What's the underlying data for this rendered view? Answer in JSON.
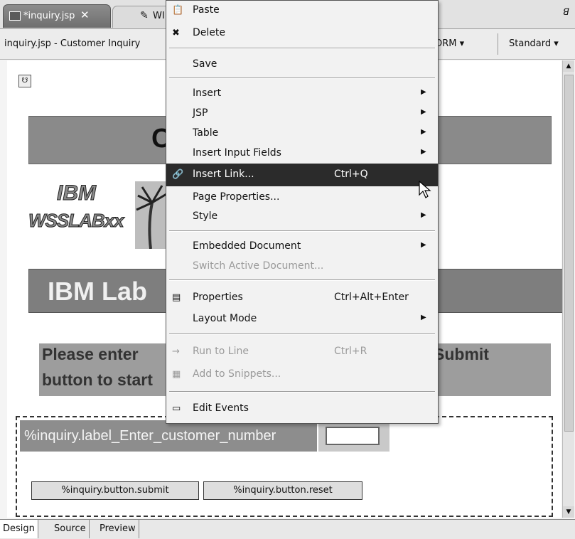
{
  "tabs": {
    "active": "*inquiry.jsp",
    "close": "✕",
    "second": "WI",
    "maximize": "ꓭ"
  },
  "toolbar": {
    "title": "inquiry.jsp - Customer Inquiry",
    "form_dropdown": "ORM ▾",
    "style_dropdown": "Standard ▾"
  },
  "page": {
    "banner1_text": "C",
    "logo_line1": "IBM",
    "logo_line2": "WSSLABxx",
    "banner2_text": "IBM Lab",
    "instruction_line1": "Please enter",
    "instruction_tail": "Submit",
    "instruction_line2": "button to start",
    "field_label": "%inquiry.label_Enter_customer_number",
    "submit_button": "%inquiry.button.submit",
    "reset_button": "%inquiry.button.reset"
  },
  "bottom_tabs": [
    "Design",
    "Source",
    "Preview"
  ],
  "context_menu": {
    "items": [
      {
        "label": "Paste",
        "icon": "paste-icon"
      },
      {
        "label": "Delete",
        "icon": "delete-icon"
      },
      {
        "label": "Save"
      },
      {
        "label": "Insert",
        "submenu": true
      },
      {
        "label": "JSP",
        "submenu": true
      },
      {
        "label": "Table",
        "submenu": true
      },
      {
        "label": "Insert Input Fields",
        "submenu": true
      },
      {
        "label": "Insert Link...",
        "shortcut": "Ctrl+Q",
        "icon": "link-icon",
        "highlighted": true
      },
      {
        "label": "Page Properties..."
      },
      {
        "label": "Style",
        "submenu": true
      },
      {
        "label": "Embedded Document",
        "submenu": true
      },
      {
        "label": "Switch Active Document...",
        "disabled": true
      },
      {
        "label": "Properties",
        "shortcut": "Ctrl+Alt+Enter",
        "icon": "properties-icon"
      },
      {
        "label": "Layout Mode",
        "submenu": true
      },
      {
        "label": "Run to Line",
        "shortcut": "Ctrl+R",
        "icon": "run-to-line-icon",
        "disabled": true
      },
      {
        "label": "Add to Snippets...",
        "icon": "snippets-icon",
        "disabled": true
      },
      {
        "label": "Edit Events",
        "icon": "edit-events-icon"
      }
    ]
  },
  "colors": {
    "highlight": "#2b2b2b",
    "menu_bg": "#f2f2f2",
    "banner": "#8a8a8a"
  }
}
